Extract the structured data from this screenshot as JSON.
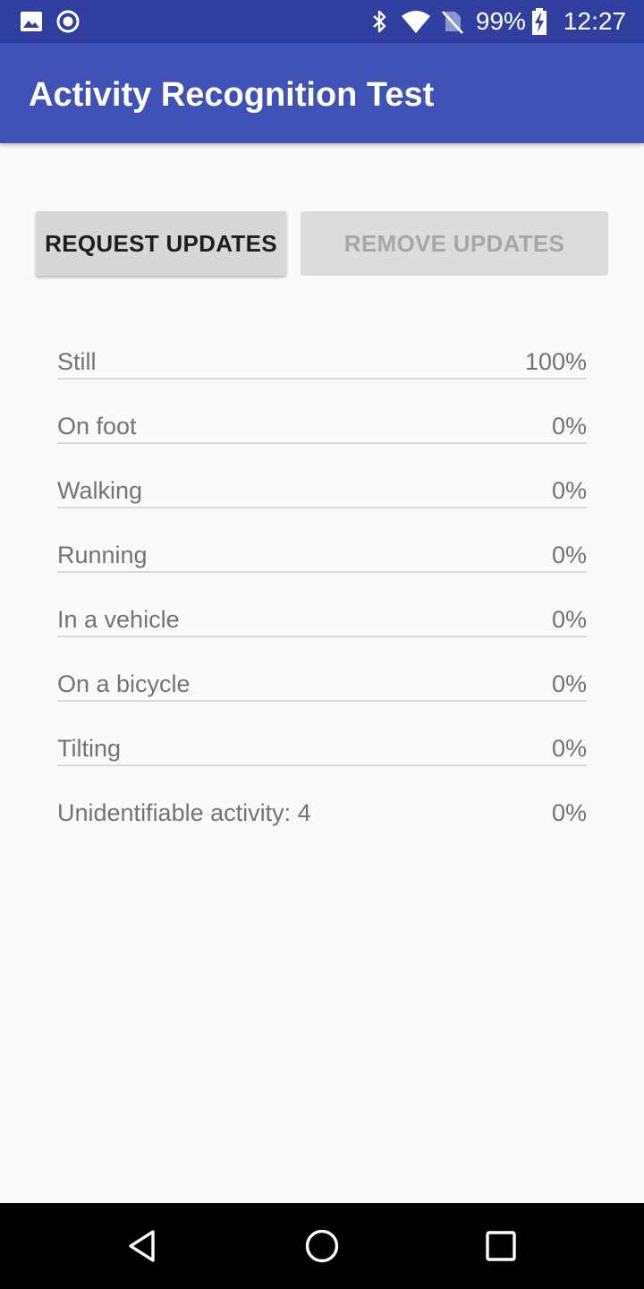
{
  "status_bar": {
    "battery_percent": "99%",
    "time": "12:27",
    "icons": [
      "image-icon",
      "record-icon",
      "bluetooth-icon",
      "wifi-icon",
      "no-sim-icon",
      "battery-charging-icon"
    ]
  },
  "app_bar": {
    "title": "Activity Recognition Test"
  },
  "buttons": {
    "request_updates": "REQUEST UPDATES",
    "remove_updates": "REMOVE UPDATES"
  },
  "activities": [
    {
      "name": "Still",
      "value": "100%"
    },
    {
      "name": "On foot",
      "value": "0%"
    },
    {
      "name": "Walking",
      "value": "0%"
    },
    {
      "name": "Running",
      "value": "0%"
    },
    {
      "name": "In a vehicle",
      "value": "0%"
    },
    {
      "name": "On a bicycle",
      "value": "0%"
    },
    {
      "name": "Tilting",
      "value": "0%"
    },
    {
      "name": "Unidentifiable activity: 4",
      "value": "0%"
    }
  ],
  "nav_bar": {
    "icons": [
      "back-icon",
      "home-icon",
      "recents-icon"
    ]
  },
  "colors": {
    "status_bar": "#303f9f",
    "app_bar": "#3f51b5",
    "background": "#fafafa"
  }
}
